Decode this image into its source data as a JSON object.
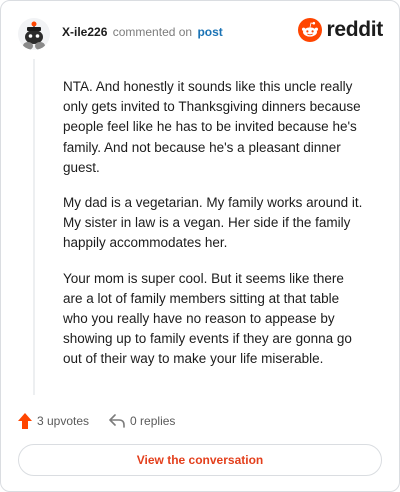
{
  "header": {
    "username": "X-ile226",
    "action_text": "commented on",
    "post_link": "post",
    "brand_name": "reddit",
    "brand_color": "#ff4500"
  },
  "comment": {
    "paragraphs": [
      "NTA. And honestly it sounds like this uncle really only gets invited to Thanksgiving dinners because people feel like he has to be invited because he's family. And not because he's a pleasant dinner guest.",
      "My dad is a vegetarian. My family works around it. My sister in law is a vegan. Her side if the family happily accommodates her.",
      "Your mom is super cool. But it seems like there are a lot of family members sitting at that table who you really have no reason to appease by showing up to family events if they are gonna go out of their way to make your life miserable."
    ]
  },
  "footer": {
    "upvotes_label": "3 upvotes",
    "replies_label": "0 replies",
    "cta_label": "View the conversation"
  },
  "icons": {
    "upvote": "upvote-arrow-icon",
    "reply": "reply-arrow-icon",
    "avatar": "user-avatar-icon",
    "brand": "reddit-logo-icon"
  }
}
